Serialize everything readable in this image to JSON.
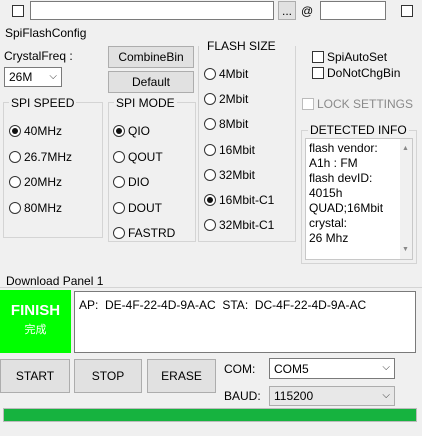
{
  "top_bar": {
    "browse_label": "...",
    "at_label": "@"
  },
  "config": {
    "section_title": "SpiFlashConfig",
    "crystal_label": "CrystalFreq :",
    "crystal_value": "26M",
    "combine_button": "CombineBin",
    "default_button": "Default"
  },
  "flash_size": {
    "title": "FLASH SIZE",
    "options": [
      "4Mbit",
      "2Mbit",
      "8Mbit",
      "16Mbit",
      "32Mbit",
      "16Mbit-C1",
      "32Mbit-C1"
    ],
    "selected": "16Mbit-C1"
  },
  "spi_speed": {
    "title": "SPI SPEED",
    "options": [
      "40MHz",
      "26.7MHz",
      "20MHz",
      "80MHz"
    ],
    "selected": "40MHz"
  },
  "spi_mode": {
    "title": "SPI MODE",
    "options": [
      "QIO",
      "QOUT",
      "DIO",
      "DOUT",
      "FASTRD"
    ],
    "selected": "QIO"
  },
  "options": {
    "spi_auto_set": "SpiAutoSet",
    "do_not_chg_bin": "DoNotChgBin",
    "lock_settings": "LOCK SETTINGS"
  },
  "detected": {
    "title": "DETECTED INFO",
    "lines": [
      "flash vendor:",
      "A1h : FM",
      "flash devID:",
      "4015h",
      "QUAD;16Mbit",
      "crystal:",
      "26 Mhz"
    ]
  },
  "download": {
    "panel_title": "Download Panel 1",
    "status": "FINISH",
    "status_sub": "完成",
    "status_color": "#00ff00",
    "log_text": "AP:  DE-4F-22-4D-9A-AC  STA:  DC-4F-22-4D-9A-AC"
  },
  "actions": {
    "start": "START",
    "stop": "STOP",
    "erase": "ERASE"
  },
  "port": {
    "com_label": "COM:",
    "com_value": "COM5",
    "baud_label": "BAUD:",
    "baud_value": "115200"
  },
  "progress": {
    "fraction": 1.0,
    "color": "#16b33f"
  }
}
